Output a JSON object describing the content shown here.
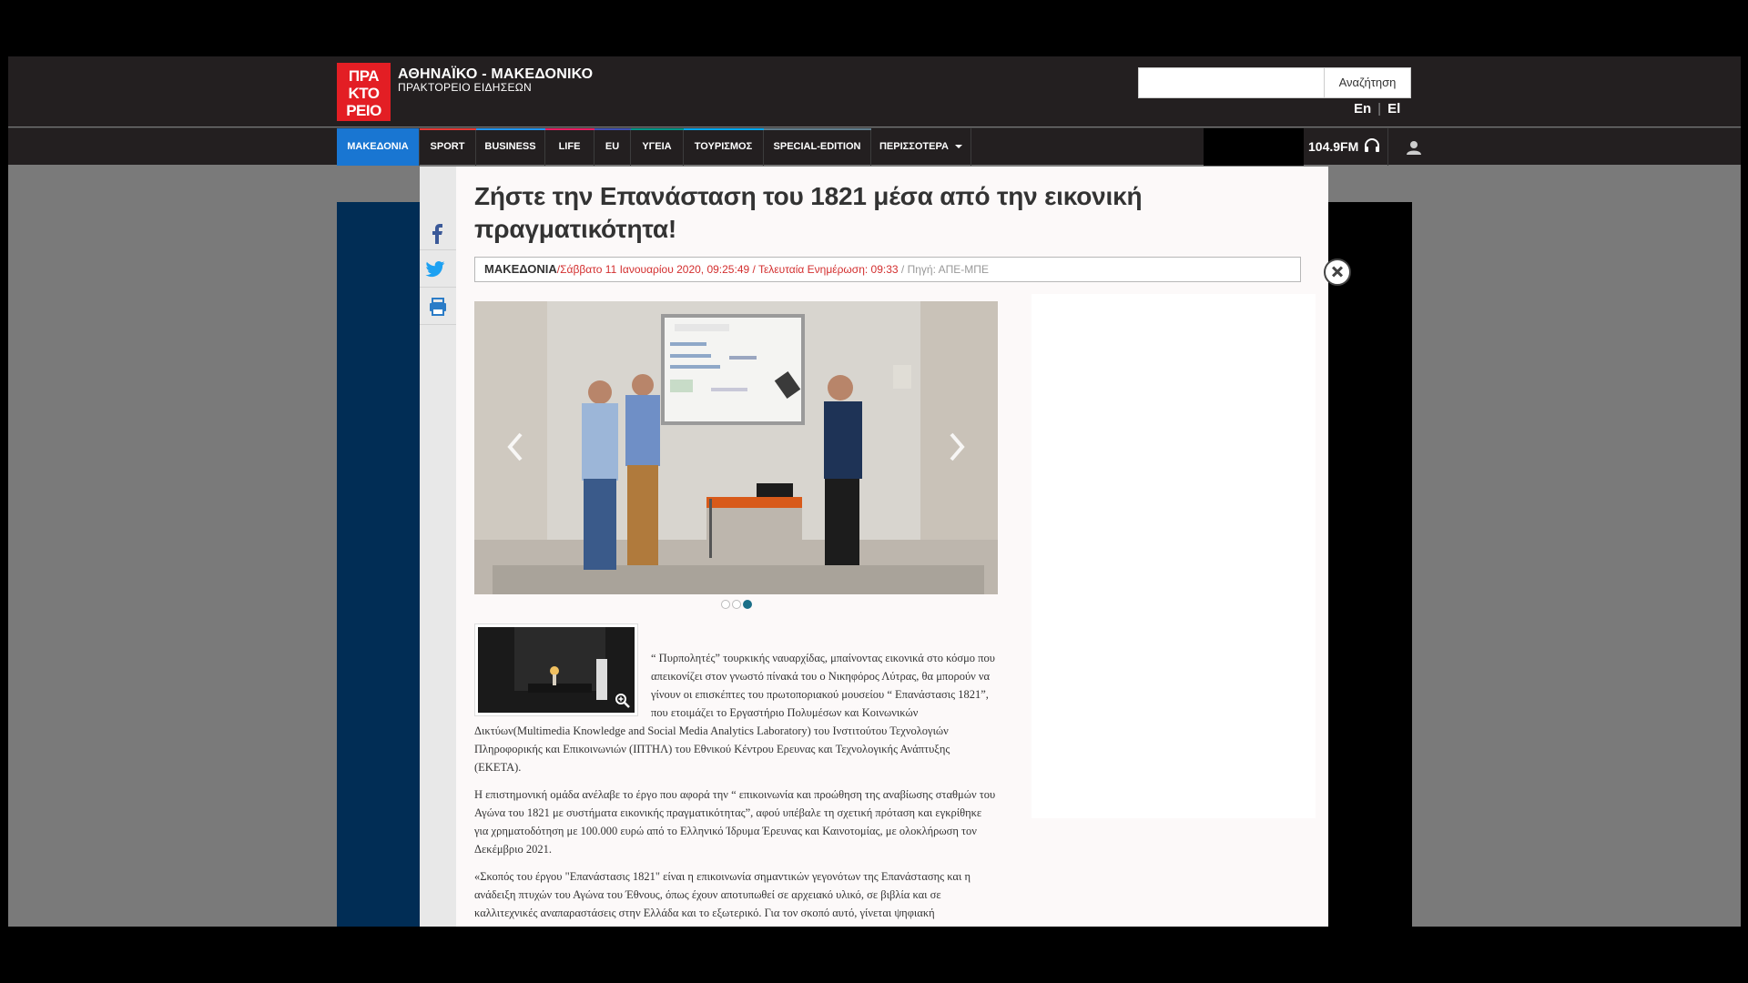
{
  "header": {
    "logo_text": "ΠΡΑ\nΚΤΟ\nΡΕΙΟ",
    "brand_title": "ΑΘΗΝΑΪΚΟ - ΜΑΚΕΔΟΝΙΚΟ",
    "brand_subtitle": "ΠΡΑΚΤΟΡΕΙΟ ΕΙΔΗΣΕΩΝ",
    "search_placeholder": "",
    "search_button": "Αναζήτηση",
    "lang_en": "En",
    "lang_el": "El"
  },
  "nav": {
    "items": [
      {
        "label": "ΜΑΚΕΔΟΝΙΑ",
        "color": "#1976d2"
      },
      {
        "label": "SPORT",
        "color": "#e53935"
      },
      {
        "label": "BUSINESS",
        "color": "#2196f3"
      },
      {
        "label": "LIFE",
        "color": "#e91e63"
      },
      {
        "label": "EU",
        "color": "#3f51b5"
      },
      {
        "label": "ΥΓΕΙΑ",
        "color": "#009688"
      },
      {
        "label": "ΤΟΥΡΙΣΜΟΣ",
        "color": "#03a9f4"
      },
      {
        "label": "SPECIAL-EDITION",
        "color": "#607d8b"
      },
      {
        "label": "ΠΕΡΙΣΣΟΤΕΡΑ",
        "color": "#9e9e9e"
      }
    ],
    "radio_label": "104.9FM"
  },
  "article": {
    "title": "Ζήστε την Επανάσταση του 1821 μέσα από την εικονική πραγματικότητα!",
    "category": "ΜΑΚΕΔΟΝΙΑ",
    "date": "/Σάββατο 11 Ιανουαρίου 2020, 09:25:49 / Τελευταία Ενημέρωση: 09:33",
    "source": " / Πηγή: ΑΠΕ-ΜΠΕ",
    "slider_total": 3,
    "slider_active": 3,
    "paragraphs": [
      "“ Πυρπολητές” τουρκικής ναυαρχίδας, μπαίνοντας εικονικά στο κόσμο που απεικονίζει στον γνωστό πίνακά του ο Νικηφόρος Λύτρας, θα μπορούν να γίνουν οι επισκέπτες του πρωτοποριακού μουσείου “ Επανάστασις 1821”, που ετοιμάζει το Εργαστήριο Πολυμέσων και Κοινωνικών Δικτύων(Multimedia Knowledge and Social Media Analytics Laboratory) του Ινστιτούτου Τεχνολογιών Πληροφορικής και Επικοινωνιών (ΙΠΤΗΛ) του Εθνικού Κέντρου Ερευνας και Τεχνολογικής Ανάπτυξης (ΕΚΕΤΑ).",
      "Η επιστημονική ομάδα ανέλαβε το έργο που αφορά την “ επικοινωνία και προώθηση της αναβίωσης σταθμών του Αγώνα του 1821 με συστήματα εικονικής πραγματικότητας”, αφού υπέβαλε τη σχετική πρόταση και εγκρίθηκε για χρηματοδότηση με 100.000 ευρώ από το Ελληνικό Ίδρυμα Έρευνας και Καινοτομίας, με ολοκλήρωση τον Δεκέμβριο 2021.",
      "«Σκοπός του έργου \"Επανάστασις 1821\" είναι η επικοινωνία σημαντικών γεγονότων της Επανάστασης και η ανάδειξη πτυχών του Αγώνα του Έθνους, όπως έχουν αποτυπωθεί σε αρχειακό υλικό, σε βιβλία και σε καλλιτεχνικές αναπαραστάσεις στην Ελλάδα και το εξωτερικό. Για τον σκοπό αυτό, γίνεται ψηφιακή αναπαράσταση και αναβίωση αντικειμένων και γεγονότων, με έμφαση στις"
    ]
  }
}
